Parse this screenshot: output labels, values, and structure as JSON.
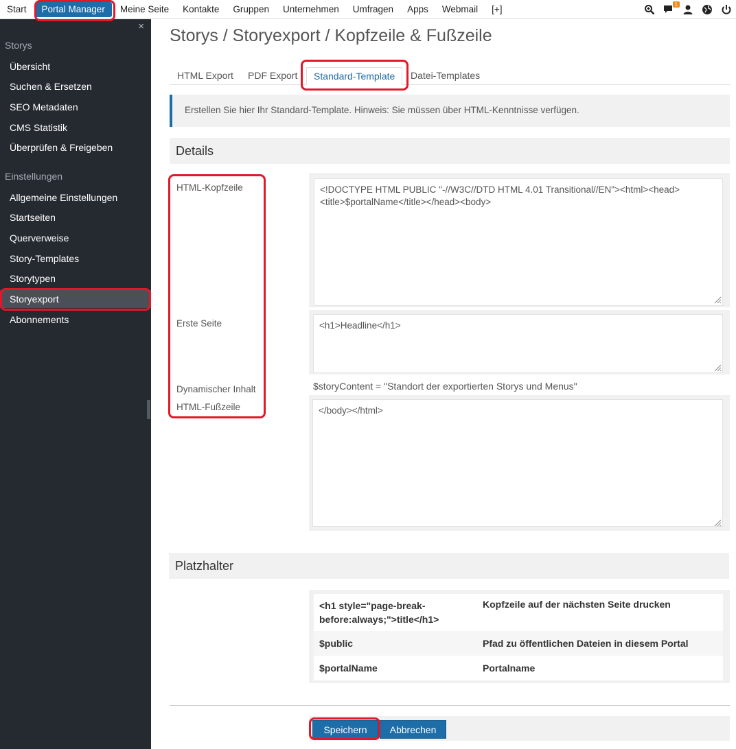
{
  "topnav": {
    "items": [
      "Start",
      "Portal Manager",
      "Meine Seite",
      "Kontakte",
      "Gruppen",
      "Unternehmen",
      "Umfragen",
      "Apps",
      "Webmail",
      "[+]"
    ],
    "active_index": 1,
    "notification_count": "1"
  },
  "sidebar": {
    "close_label": "×",
    "sections": [
      {
        "title": "Storys",
        "items": [
          "Übersicht",
          "Suchen & Ersetzen",
          "SEO Metadaten",
          "CMS Statistik",
          "Überprüfen & Freigeben"
        ]
      },
      {
        "title": "Einstellungen",
        "items": [
          "Allgemeine Einstellungen",
          "Startseiten",
          "Querverweise",
          "Story-Templates",
          "Storytypen",
          "Storyexport",
          "Abonnements"
        ]
      }
    ],
    "active_item": "Storyexport"
  },
  "page": {
    "title": "Storys / Storyexport / Kopfzeile & Fußzeile",
    "tabs": [
      "HTML Export",
      "PDF Export",
      "Standard-Template",
      "Datei-Templates"
    ],
    "active_tab": "Standard-Template",
    "info_text": "Erstellen Sie hier Ihr Standard-Template. Hinweis: Sie müssen über HTML-Kenntnisse verfügen."
  },
  "details": {
    "heading": "Details",
    "header_label": "HTML-Kopfzeile",
    "header_value": "<!DOCTYPE HTML PUBLIC \"-//W3C//DTD HTML 4.01 Transitional//EN\"><html><head><title>$portalName</title></head><body>",
    "first_page_label": "Erste Seite",
    "first_page_value": "<h1>Headline</h1>",
    "dynamic_label": "Dynamischer Inhalt",
    "dynamic_value": "$storyContent = \"Standort der exportierten Storys und Menus\"",
    "footer_label": "HTML-Fußzeile",
    "footer_value": "</body></html>"
  },
  "placeholders": {
    "heading": "Platzhalter",
    "rows": [
      {
        "code": "<h1 style=\"page-break-before:always;\">title</h1>",
        "description": "Kopfzeile auf der nächsten Seite drucken"
      },
      {
        "code": "$public",
        "description": "Pfad zu öffentlichen Dateien in diesem Portal"
      },
      {
        "code": "$portalName",
        "description": "Portalname"
      }
    ]
  },
  "actions": {
    "save": "Speichern",
    "cancel": "Abbrechen"
  },
  "colors": {
    "accent": "#1c6da8",
    "sidebar_bg": "#252a31",
    "sidebar_active": "#4b5058",
    "annotation": "#e0182a",
    "badge": "#f08a1c"
  }
}
